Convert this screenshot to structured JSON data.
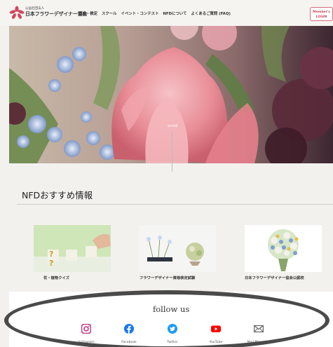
{
  "header": {
    "org_type": "公益社団法人",
    "org_name": "日本フラワーデザイナー協会",
    "nav": [
      "資格・検定",
      "スクール",
      "イベント・コンテスト",
      "NFDについて",
      "よくあるご質問 (FAQ)"
    ],
    "login_line1": "Member's",
    "login_line2": "LOGIN"
  },
  "hero": {
    "scroll_label": "scroll"
  },
  "recommend": {
    "title": "NFDおすすめ情報",
    "cards": [
      {
        "label": "花・植物クイズ",
        "image_text": "? ?"
      },
      {
        "label": "フラワーデザイナー資格検定試験"
      },
      {
        "label": "日本フラワーデザイナー協会公認校"
      }
    ]
  },
  "follow": {
    "title": "follow us",
    "links": [
      {
        "label": "Instagram",
        "icon": "instagram-icon",
        "color": "#c13584"
      },
      {
        "label": "Facebook",
        "icon": "facebook-icon",
        "color": "#1877f2"
      },
      {
        "label": "Twitter",
        "icon": "twitter-icon",
        "color": "#1d9bf0"
      },
      {
        "label": "YouTube",
        "icon": "youtube-icon",
        "color": "#ff0000"
      },
      {
        "label": "Mail Magazine",
        "icon": "mail-icon",
        "color": "#666666"
      }
    ]
  },
  "colors": {
    "brand_pink": "#d0475d",
    "background": "#f3f1ee"
  }
}
